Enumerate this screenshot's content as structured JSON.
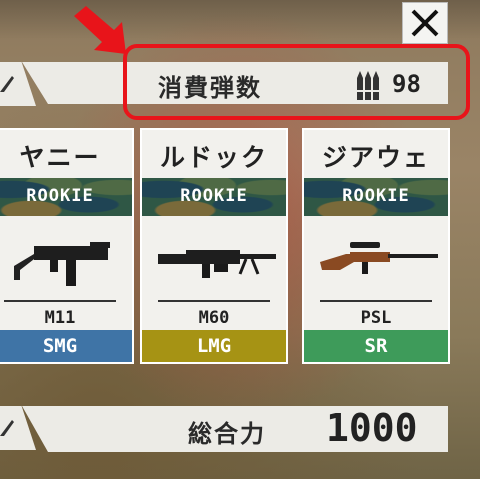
{
  "header": {
    "close_icon": "close-x-icon",
    "pointer_icon": "red-arrow-icon"
  },
  "consumption": {
    "label": "消費弾数",
    "icon": "ammo-bullets-icon",
    "value": "98"
  },
  "cards": [
    {
      "name": "ヤニー",
      "rank": "ROOKIE",
      "weapon": "M11",
      "class": "SMG",
      "class_color": "#3f74a6"
    },
    {
      "name": "ルドック",
      "rank": "ROOKIE",
      "weapon": "M60",
      "class": "LMG",
      "class_color": "#a69314"
    },
    {
      "name": "ジアウェ",
      "rank": "ROOKIE",
      "weapon": "PSL",
      "class": "SR",
      "class_color": "#3e9b5a"
    }
  ],
  "total": {
    "label": "総合力",
    "value": "1000"
  },
  "colors": {
    "highlight": "#e8141a",
    "bar_bg": "#ecebe6"
  }
}
